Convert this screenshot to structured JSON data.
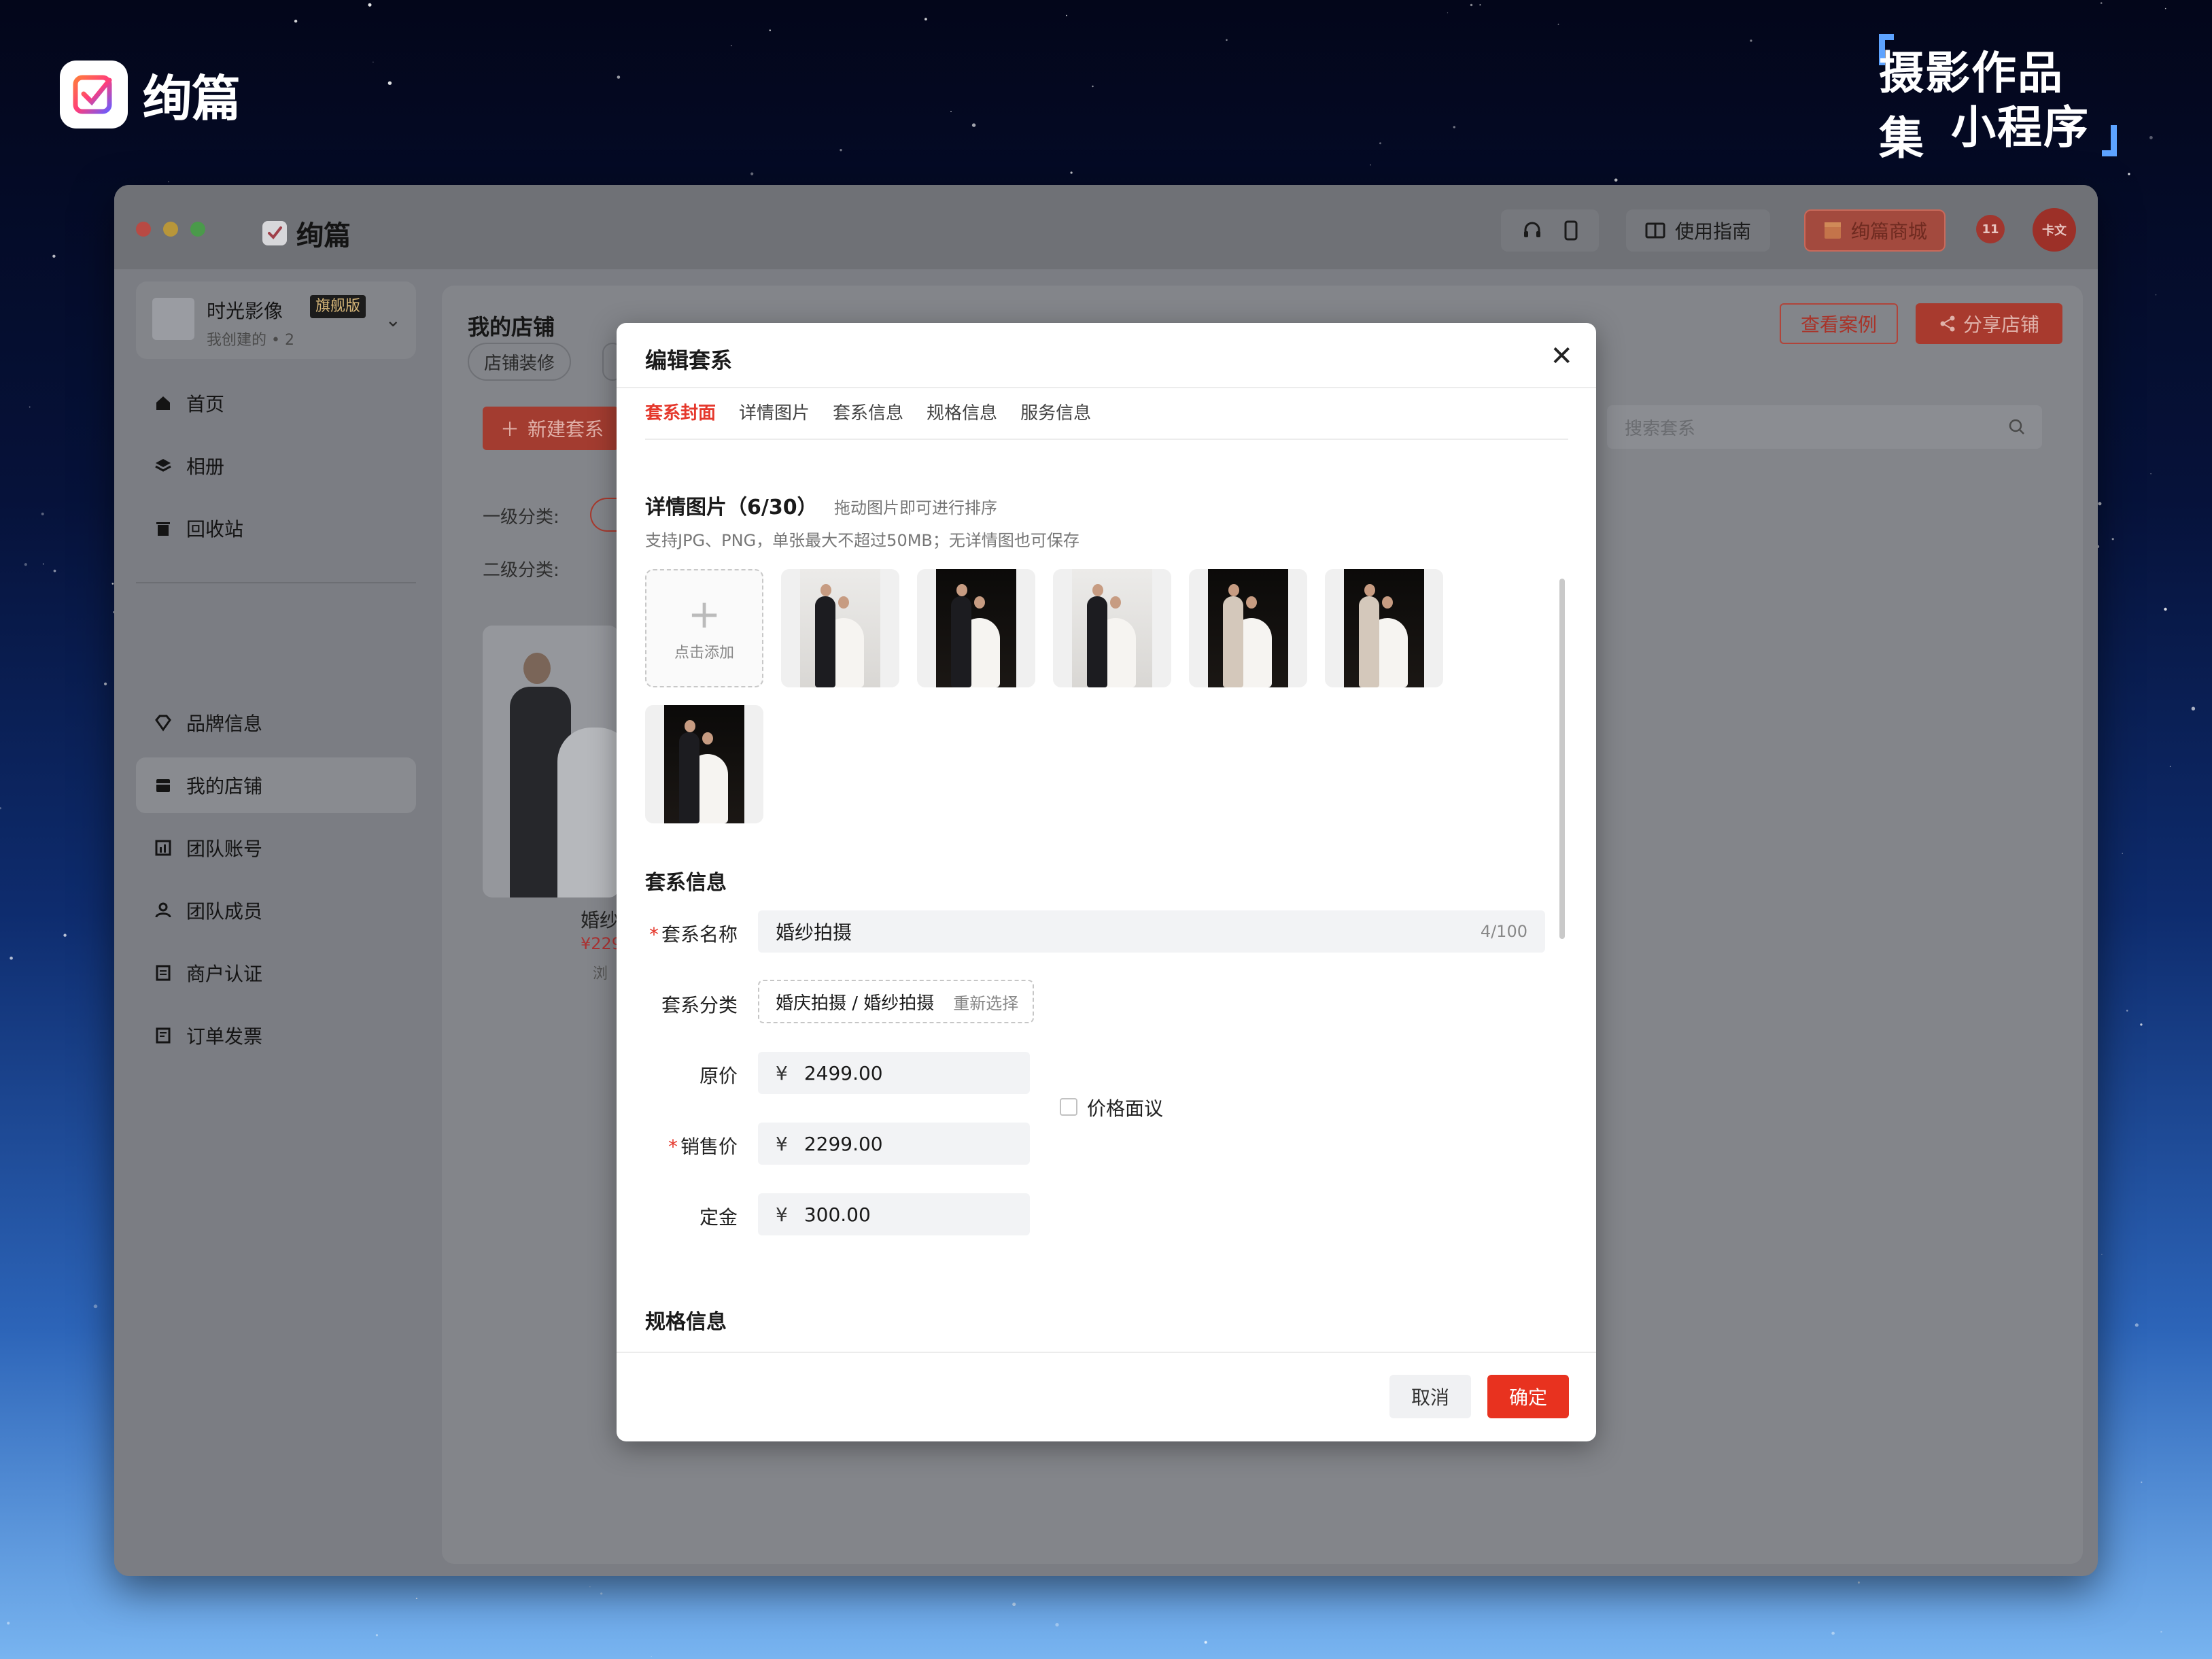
{
  "brand": {
    "name": "绚篇"
  },
  "tagline": {
    "line1": "摄影作品集",
    "line2": "小程序"
  },
  "topbar": {
    "logo_text": "绚篇",
    "guide_label": "使用指南",
    "mall_label": "绚篇商城",
    "notif_badge": "11",
    "avatar_text": "卡文"
  },
  "sidebar": {
    "account": {
      "name": "时光影像",
      "badge": "旗舰版",
      "sub": "我创建的 • 2"
    },
    "items": [
      {
        "label": "首页",
        "icon": "home-icon"
      },
      {
        "label": "相册",
        "icon": "layers-icon"
      },
      {
        "label": "回收站",
        "icon": "trash-icon"
      },
      {
        "label": "品牌信息",
        "icon": "gem-icon"
      },
      {
        "label": "我的店铺",
        "icon": "store-icon"
      },
      {
        "label": "团队账号",
        "icon": "chart-icon"
      },
      {
        "label": "团队成员",
        "icon": "team-icon"
      },
      {
        "label": "商户认证",
        "icon": "doc-icon"
      },
      {
        "label": "订单发票",
        "icon": "receipt-icon"
      }
    ]
  },
  "main": {
    "title": "我的店铺",
    "tab_pill": "店铺装修",
    "view_cases": "查看案例",
    "share_store": "分享店铺",
    "new_button": "新建套系",
    "search_placeholder": "搜索套系",
    "level1_label": "一级分类:",
    "level2_label": "二级分类:",
    "card_title": "婚纱",
    "card_price": "¥229",
    "card_meta": "浏"
  },
  "modal": {
    "title": "编辑套系",
    "tabs": [
      "套系封面",
      "详情图片",
      "套系信息",
      "规格信息",
      "服务信息"
    ],
    "detail_title": "详情图片（6/30）",
    "detail_hint": "拖动图片即可进行排序",
    "detail_sub": "支持JPG、PNG，单张最大不超过50MB；无详情图也可保存",
    "add_label": "点击添加",
    "info_title": "套系信息",
    "name_label": "套系名称",
    "name_value": "婚纱拍摄",
    "name_count": "4/100",
    "category_label": "套系分类",
    "category_value": "婚庆拍摄 / 婚纱拍摄",
    "category_reselect": "重新选择",
    "currency": "¥",
    "orig_label": "原价",
    "orig_value": "2499.00",
    "sale_label": "销售价",
    "sale_value": "2299.00",
    "negotiable_label": "价格面议",
    "deposit_label": "定金",
    "deposit_value": "300.00",
    "spec_title": "规格信息",
    "cancel_label": "取消",
    "confirm_label": "确定"
  },
  "colors": {
    "accent": "#e5372b",
    "confirm": "#e8321f",
    "dim_window": "#7b7d83"
  }
}
